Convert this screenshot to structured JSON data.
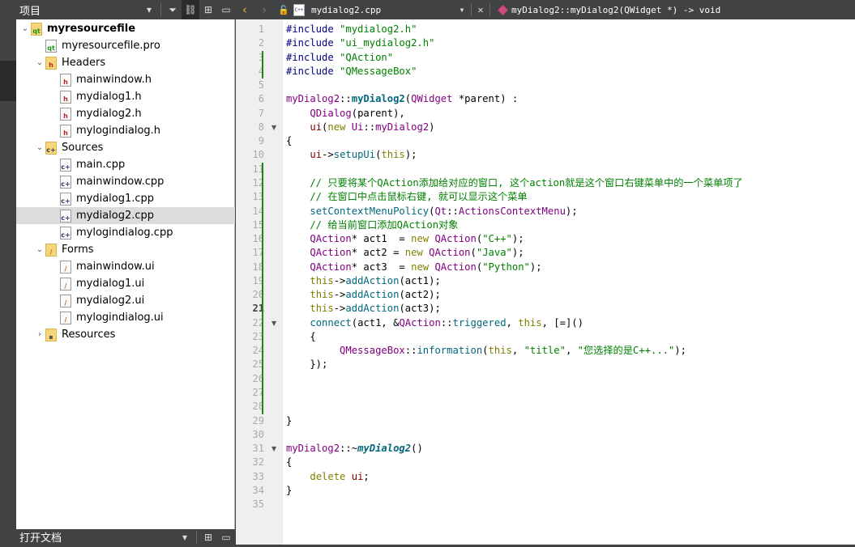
{
  "sidebar": {
    "title": "项目",
    "bottom_title": "打开文档",
    "items": [
      {
        "label": "myresourcefile",
        "level": 0,
        "expanded": true,
        "icon": "qt-project-folder",
        "bold": true
      },
      {
        "label": "myresourcefile.pro",
        "level": 1,
        "icon": "qt-pro-file"
      },
      {
        "label": "Headers",
        "level": 1,
        "expanded": true,
        "icon": "header-folder"
      },
      {
        "label": "mainwindow.h",
        "level": 2,
        "icon": "header-file"
      },
      {
        "label": "mydialog1.h",
        "level": 2,
        "icon": "header-file"
      },
      {
        "label": "mydialog2.h",
        "level": 2,
        "icon": "header-file"
      },
      {
        "label": "mylogindialog.h",
        "level": 2,
        "icon": "header-file"
      },
      {
        "label": "Sources",
        "level": 1,
        "expanded": true,
        "icon": "source-folder"
      },
      {
        "label": "main.cpp",
        "level": 2,
        "icon": "cpp-file"
      },
      {
        "label": "mainwindow.cpp",
        "level": 2,
        "icon": "cpp-file"
      },
      {
        "label": "mydialog1.cpp",
        "level": 2,
        "icon": "cpp-file"
      },
      {
        "label": "mydialog2.cpp",
        "level": 2,
        "icon": "cpp-file",
        "selected": true
      },
      {
        "label": "mylogindialog.cpp",
        "level": 2,
        "icon": "cpp-file"
      },
      {
        "label": "Forms",
        "level": 1,
        "expanded": true,
        "icon": "forms-folder"
      },
      {
        "label": "mainwindow.ui",
        "level": 2,
        "icon": "ui-file"
      },
      {
        "label": "mydialog1.ui",
        "level": 2,
        "icon": "ui-file"
      },
      {
        "label": "mydialog2.ui",
        "level": 2,
        "icon": "ui-file"
      },
      {
        "label": "mylogindialog.ui",
        "level": 2,
        "icon": "ui-file"
      },
      {
        "label": "Resources",
        "level": 1,
        "expanded": false,
        "icon": "resources-folder"
      }
    ]
  },
  "editor": {
    "file": "mydialog2.cpp",
    "symbol": "myDialog2::myDialog2(QWidget *) -> void",
    "current_line": 21,
    "fold_lines": [
      8,
      22,
      31
    ],
    "changed_ranges": [
      [
        3,
        4
      ],
      [
        11,
        28
      ]
    ],
    "lines": [
      [
        [
          "#include",
          "pp"
        ],
        [
          " "
        ],
        [
          "\"mydialog2.h\"",
          "str"
        ]
      ],
      [
        [
          "#include",
          "pp"
        ],
        [
          " "
        ],
        [
          "\"ui_mydialog2.h\"",
          "str"
        ]
      ],
      [
        [
          "#include",
          "pp"
        ],
        [
          " "
        ],
        [
          "\"QAction\"",
          "str"
        ]
      ],
      [
        [
          "#include",
          "pp"
        ],
        [
          " "
        ],
        [
          "\"QMessageBox\"",
          "str"
        ]
      ],
      [],
      [
        [
          "myDialog2",
          "type"
        ],
        [
          "::"
        ],
        [
          "myDialog2",
          "fdecl"
        ],
        [
          "("
        ],
        [
          "QWidget",
          "type"
        ],
        [
          " *parent) :"
        ]
      ],
      [
        [
          "    "
        ],
        [
          "QDialog",
          "type"
        ],
        [
          "(parent),"
        ]
      ],
      [
        [
          "    "
        ],
        [
          "ui",
          "field"
        ],
        [
          "("
        ],
        [
          "new",
          "kw"
        ],
        [
          " "
        ],
        [
          "Ui",
          "type"
        ],
        [
          "::"
        ],
        [
          "myDialog2",
          "type"
        ],
        [
          ")"
        ]
      ],
      [
        [
          "{"
        ]
      ],
      [
        [
          "    "
        ],
        [
          "ui",
          "field"
        ],
        [
          "->"
        ],
        [
          "setupUi",
          "func"
        ],
        [
          "("
        ],
        [
          "this",
          "kw"
        ],
        [
          ");"
        ]
      ],
      [],
      [
        [
          "    // 只要将某个QAction添加给对应的窗口, 这个action就是这个窗口右键菜单中的一个菜单项了",
          "cmt"
        ]
      ],
      [
        [
          "    // 在窗口中点击鼠标右键, 就可以显示这个菜单",
          "cmt"
        ]
      ],
      [
        [
          "    "
        ],
        [
          "setContextMenuPolicy",
          "func"
        ],
        [
          "("
        ],
        [
          "Qt",
          "type"
        ],
        [
          "::"
        ],
        [
          "ActionsContextMenu",
          "type"
        ],
        [
          ");"
        ]
      ],
      [
        [
          "    // 给当前窗口添加QAction对象",
          "cmt"
        ]
      ],
      [
        [
          "    "
        ],
        [
          "QAction",
          "type"
        ],
        [
          "* act1  = "
        ],
        [
          "new",
          "kw"
        ],
        [
          " "
        ],
        [
          "QAction",
          "type"
        ],
        [
          "("
        ],
        [
          "\"C++\"",
          "str"
        ],
        [
          ");"
        ]
      ],
      [
        [
          "    "
        ],
        [
          "QAction",
          "type"
        ],
        [
          "* act2 = "
        ],
        [
          "new",
          "kw"
        ],
        [
          " "
        ],
        [
          "QAction",
          "type"
        ],
        [
          "("
        ],
        [
          "\"Java\"",
          "str"
        ],
        [
          ");"
        ]
      ],
      [
        [
          "    "
        ],
        [
          "QAction",
          "type"
        ],
        [
          "* act3  = "
        ],
        [
          "new",
          "kw"
        ],
        [
          " "
        ],
        [
          "QAction",
          "type"
        ],
        [
          "("
        ],
        [
          "\"Python\"",
          "str"
        ],
        [
          ");"
        ]
      ],
      [
        [
          "    "
        ],
        [
          "this",
          "kw"
        ],
        [
          "->"
        ],
        [
          "addAction",
          "func"
        ],
        [
          "(act1);"
        ]
      ],
      [
        [
          "    "
        ],
        [
          "this",
          "kw"
        ],
        [
          "->"
        ],
        [
          "addAction",
          "func"
        ],
        [
          "(act2);"
        ]
      ],
      [
        [
          "    "
        ],
        [
          "this",
          "kw"
        ],
        [
          "->"
        ],
        [
          "addAction",
          "func"
        ],
        [
          "(act3);"
        ]
      ],
      [
        [
          "    "
        ],
        [
          "connect",
          "func"
        ],
        [
          "(act1, &"
        ],
        [
          "QAction",
          "type"
        ],
        [
          "::"
        ],
        [
          "triggered",
          "func"
        ],
        [
          ", "
        ],
        [
          "this",
          "kw"
        ],
        [
          ", [=]()"
        ]
      ],
      [
        [
          "    {"
        ]
      ],
      [
        [
          "         "
        ],
        [
          "QMessageBox",
          "type"
        ],
        [
          "::"
        ],
        [
          "information",
          "func"
        ],
        [
          "("
        ],
        [
          "this",
          "kw"
        ],
        [
          ", "
        ],
        [
          "\"title\"",
          "str"
        ],
        [
          ", "
        ],
        [
          "\"您选择的是C++...\"",
          "str"
        ],
        [
          ");"
        ]
      ],
      [
        [
          "    });"
        ]
      ],
      [],
      [],
      [],
      [
        [
          "}"
        ]
      ],
      [],
      [
        [
          "myDialog2",
          "type"
        ],
        [
          "::~"
        ],
        [
          "myDialog2",
          "fital"
        ],
        [
          "()"
        ]
      ],
      [
        [
          "{"
        ]
      ],
      [
        [
          "    "
        ],
        [
          "delete",
          "kw"
        ],
        [
          " "
        ],
        [
          "ui",
          "field"
        ],
        [
          ";"
        ]
      ],
      [
        [
          "}"
        ]
      ],
      []
    ]
  }
}
